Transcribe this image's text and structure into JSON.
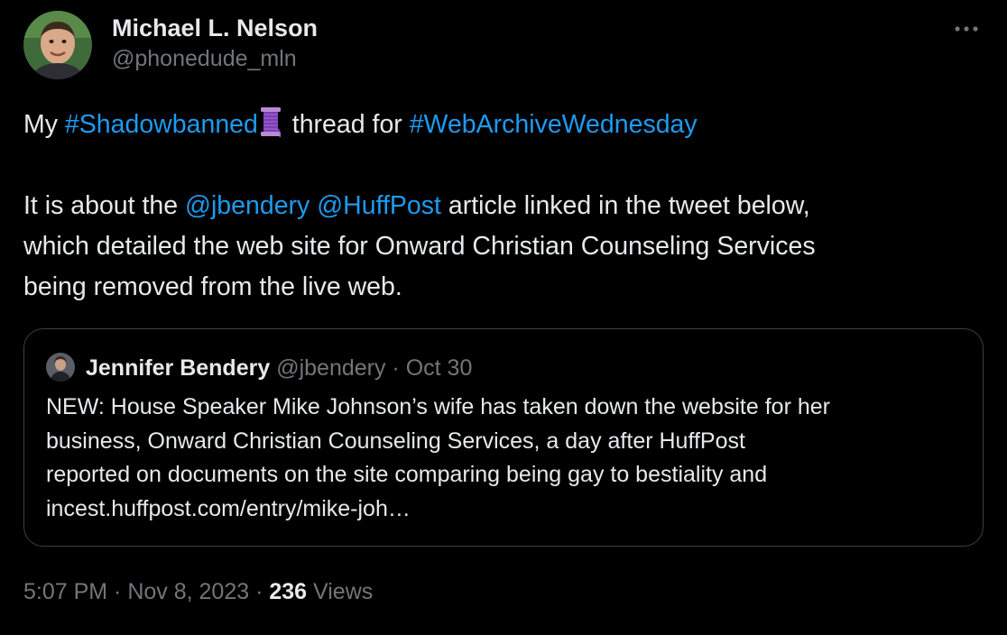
{
  "author": {
    "name": "Michael L. Nelson",
    "handle": "@phonedude_mln"
  },
  "tweet": {
    "line1": {
      "prefix": "My ",
      "hashtag1": "#Shadowbanned",
      "emoji": "spool-of-thread-icon",
      "middle": " thread for ",
      "hashtag2": "#WebArchiveWednesday"
    },
    "line2": {
      "prefix": "It is about the ",
      "mention1": "@jbendery",
      "mention2": "@HuffPost",
      "suffix": " article linked in the tweet below,"
    },
    "line3": "which detailed the web site for Onward Christian Counseling Services",
    "line4": "being removed from the live web."
  },
  "quoted_tweet": {
    "name": "Jennifer Bendery",
    "handle": "@jbendery",
    "date": " · Oct 30",
    "lines": [
      "NEW: House Speaker Mike Johnson’s wife has taken down the website for her",
      "business, Onward Christian Counseling Services, a day after HuffPost",
      "reported on documents on the site comparing being gay to bestiality and",
      "incest.huffpost.com/entry/mike-joh…"
    ]
  },
  "footer": {
    "timestamp": "5:07 PM · Nov 8, 2023 · ",
    "views_count": "236",
    "views_label": " Views"
  },
  "icons": {
    "more": "more-options-icon",
    "avatar": "avatar",
    "quoted_avatar": "avatar"
  },
  "colors": {
    "background": "#000000",
    "text": "#e7e9ea",
    "secondary": "#71767b",
    "link": "#1d9bf0",
    "border": "#3a3f45"
  }
}
